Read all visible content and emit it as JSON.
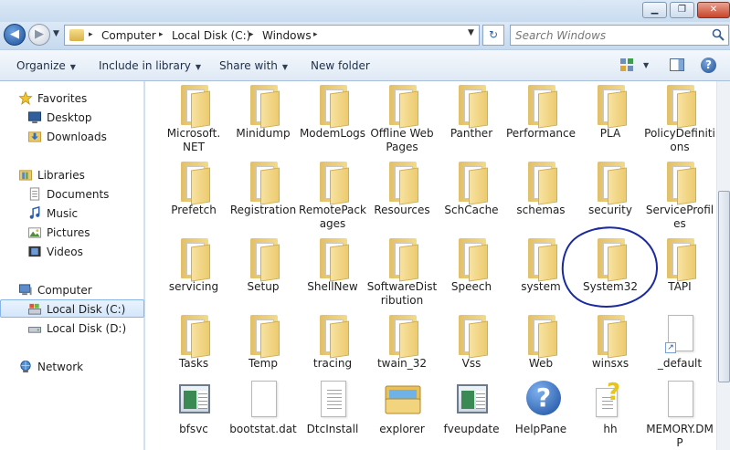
{
  "window": {
    "min_label": "▁",
    "max_label": "❐",
    "close_label": "✕"
  },
  "nav": {
    "back_glyph": "◀",
    "forward_glyph": "▶",
    "history_caret": "▼",
    "breadcrumbs": [
      "Computer",
      "Local Disk (C:)",
      "Windows"
    ],
    "crumb_sep": "▸",
    "address_caret": "▼",
    "refresh_glyph": "↻",
    "search_placeholder": "Search Windows"
  },
  "toolbar": {
    "organize": "Organize",
    "include_in_library": "Include in library",
    "share_with": "Share with",
    "new_folder": "New folder",
    "caret": "▼",
    "help": "?"
  },
  "sidebar": {
    "favorites": "Favorites",
    "desktop": "Desktop",
    "downloads": "Downloads",
    "libraries": "Libraries",
    "documents": "Documents",
    "music": "Music",
    "pictures": "Pictures",
    "videos": "Videos",
    "computer": "Computer",
    "local_c": "Local Disk (C:)",
    "local_d": "Local Disk (D:)",
    "network": "Network"
  },
  "items": [
    {
      "label": "Microsoft.\nNET",
      "kind": "folder"
    },
    {
      "label": "Minidump",
      "kind": "folder"
    },
    {
      "label": "ModemLogs",
      "kind": "folder"
    },
    {
      "label": "Offline Web Pages",
      "kind": "folder"
    },
    {
      "label": "Panther",
      "kind": "folder"
    },
    {
      "label": "Performance",
      "kind": "folder"
    },
    {
      "label": "PLA",
      "kind": "folder"
    },
    {
      "label": "PolicyDefinitions",
      "kind": "folder"
    },
    {
      "label": "Prefetch",
      "kind": "folder"
    },
    {
      "label": "Registration",
      "kind": "folder"
    },
    {
      "label": "RemotePackages",
      "kind": "folder"
    },
    {
      "label": "Resources",
      "kind": "folder"
    },
    {
      "label": "SchCache",
      "kind": "folder"
    },
    {
      "label": "schemas",
      "kind": "folder"
    },
    {
      "label": "security",
      "kind": "folder"
    },
    {
      "label": "ServiceProfiles",
      "kind": "folder"
    },
    {
      "label": "servicing",
      "kind": "folder"
    },
    {
      "label": "Setup",
      "kind": "folder"
    },
    {
      "label": "ShellNew",
      "kind": "folder"
    },
    {
      "label": "SoftwareDistribution",
      "kind": "folder"
    },
    {
      "label": "Speech",
      "kind": "folder"
    },
    {
      "label": "system",
      "kind": "folder"
    },
    {
      "label": "System32",
      "kind": "folder"
    },
    {
      "label": "TAPI",
      "kind": "folder"
    },
    {
      "label": "Tasks",
      "kind": "folder"
    },
    {
      "label": "Temp",
      "kind": "folder"
    },
    {
      "label": "tracing",
      "kind": "folder"
    },
    {
      "label": "twain_32",
      "kind": "folder"
    },
    {
      "label": "Vss",
      "kind": "folder"
    },
    {
      "label": "Web",
      "kind": "folder"
    },
    {
      "label": "winsxs",
      "kind": "folder"
    },
    {
      "label": "_default",
      "kind": "shortcut"
    },
    {
      "label": "bfsvc",
      "kind": "app"
    },
    {
      "label": "bootstat.dat",
      "kind": "doc"
    },
    {
      "label": "DtcInstall",
      "kind": "text"
    },
    {
      "label": "explorer",
      "kind": "explorer"
    },
    {
      "label": "fveupdate",
      "kind": "app"
    },
    {
      "label": "HelpPane",
      "kind": "help"
    },
    {
      "label": "hh",
      "kind": "hh"
    },
    {
      "label": "MEMORY.DMP",
      "kind": "doc"
    }
  ]
}
